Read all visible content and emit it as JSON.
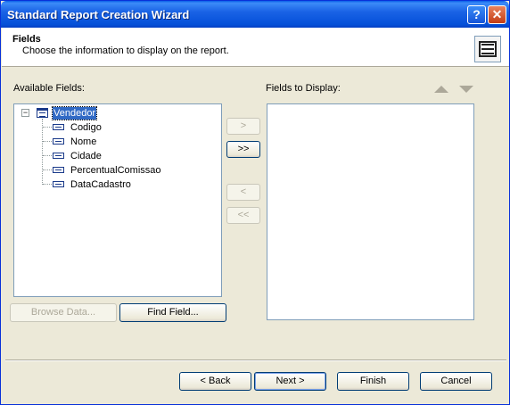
{
  "window": {
    "title": "Standard Report Creation Wizard",
    "help_label": "?",
    "close_label": "✕"
  },
  "header": {
    "title": "Fields",
    "subtitle": "Choose the information to display on the report."
  },
  "available": {
    "label": "Available Fields:",
    "root": "Vendedor",
    "root_expander": "−",
    "fields": [
      "Codigo",
      "Nome",
      "Cidade",
      "PercentualComissao",
      "DataCadastro"
    ]
  },
  "display": {
    "label": "Fields to Display:"
  },
  "transfer": {
    "add": ">",
    "add_all": ">>",
    "remove": "<",
    "remove_all": "<<"
  },
  "actions": {
    "browse": "Browse Data...",
    "find": "Find Field..."
  },
  "footer": {
    "back": "< Back",
    "next": "Next >",
    "finish": "Finish",
    "cancel": "Cancel"
  },
  "colors": {
    "titlebar": "#0a5fe8",
    "selection": "#316ac5",
    "face": "#ece9d8"
  }
}
